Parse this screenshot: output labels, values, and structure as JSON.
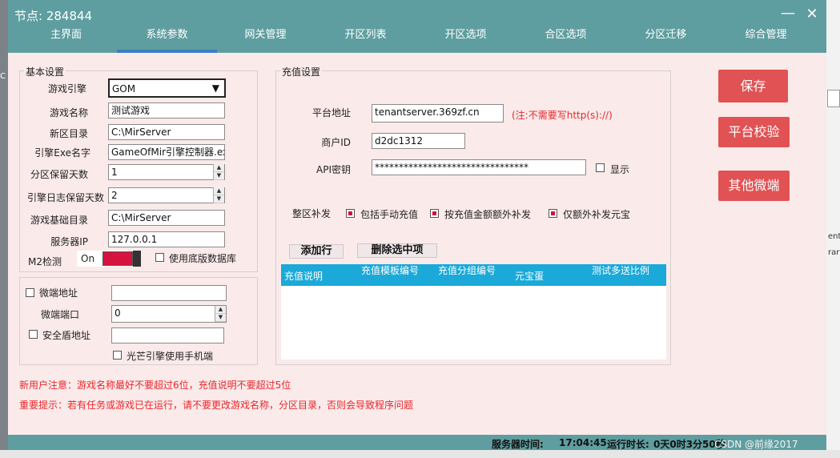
{
  "window": {
    "title": "节点:  284844",
    "minimize_icon": "minimize-icon",
    "close_icon": "close-icon"
  },
  "tabs": [
    {
      "label": "主界面",
      "active": false
    },
    {
      "label": "系统参数",
      "active": true
    },
    {
      "label": "网关管理",
      "active": false
    },
    {
      "label": "开区列表",
      "active": false
    },
    {
      "label": "开区选项",
      "active": false
    },
    {
      "label": "合区选项",
      "active": false
    },
    {
      "label": "分区迁移",
      "active": false
    },
    {
      "label": "综合管理",
      "active": false
    }
  ],
  "basic": {
    "title": "基本设置",
    "engine_label": "游戏引擎",
    "engine_value": "GOM",
    "name_label": "游戏名称",
    "name_value": "测试游戏",
    "newdir_label": "新区目录",
    "newdir_value": "C:\\MirServer",
    "exe_label": "引擎Exe名字",
    "exe_value": "GameOfMir引擎控制器.exe",
    "keepdays_label": "分区保留天数",
    "keepdays_value": "1",
    "logdays_label": "引擎日志保留天数",
    "logdays_value": "2",
    "basedir_label": "游戏基础目录",
    "basedir_value": "C:\\MirServer",
    "ip_label": "服务器IP",
    "ip_value": "127.0.0.1",
    "m2_label": "M2检测",
    "m2_value": "On",
    "bottomdb_label": "使用底版数据库",
    "bottomdb_checked": false
  },
  "micro": {
    "addr_label": "微端地址",
    "addr_checked": false,
    "addr_value": "",
    "port_label": "微端端口",
    "port_value": "0",
    "shield_label": "安全盾地址",
    "shield_checked": false,
    "shield_value": "",
    "mobile_label": "光芒引擎使用手机端",
    "mobile_checked": false
  },
  "recharge": {
    "title": "充值设置",
    "platform_label": "平台地址",
    "platform_value": "tenantserver.369zf.cn",
    "platform_note": "(注:不需要写http(s)://)",
    "merchant_label": "商户ID",
    "merchant_value": "d2dc1312",
    "apikey_label": "API密钥",
    "apikey_value": "********************************",
    "show_label": "显示",
    "show_checked": false,
    "reissue_label": "整区补发",
    "opt1_label": "包括手动充值",
    "opt1_checked": true,
    "opt2_label": "按充值金额额外补发",
    "opt2_checked": true,
    "opt3_label": "仅额外补发元宝",
    "opt3_checked": true,
    "add_row_label": "添加行",
    "delete_label": "删除选中项",
    "columns": [
      "充值说明",
      "充值模板编号",
      "充值分组编号",
      "元宝蛋",
      "测试多送比例"
    ],
    "rows": []
  },
  "actions": {
    "save": "保存",
    "verify": "平台校验",
    "other": "其他微端"
  },
  "notes": {
    "note1": "新用户注意：游戏名称最好不要超过6位，充值说明不要超过5位",
    "note2": "重要提示：若有任务或游戏已在运行，请不要更改游戏名称，分区目录，否则会导致程序问题"
  },
  "status": {
    "server_time_label": "服务器时间:",
    "server_time": "17:04:45",
    "uptime_label": "运行时长:",
    "uptime": "0天0时3分50秒",
    "watermark": "CSDN @前缘2017"
  },
  "colors": {
    "titlebar": "#5f9ea0",
    "window_bg": "#fbeaea",
    "accent_red": "#e05253",
    "table_header": "#1aa9d8",
    "note_red": "#e8262a"
  },
  "background": {
    "frag1": "C",
    "frag2": "ent",
    "frag3": "rary"
  }
}
